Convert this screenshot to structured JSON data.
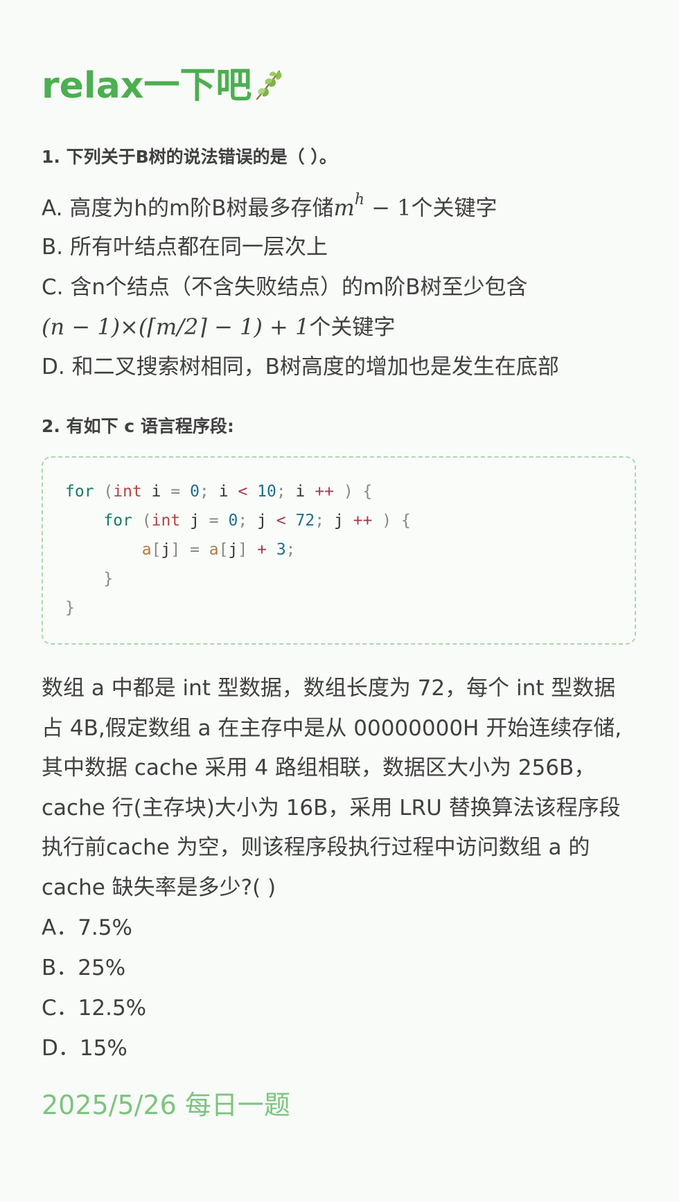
{
  "title": {
    "text": "relax一下吧",
    "icon": "leaf-icon"
  },
  "q1": {
    "heading": "1. 下列关于B树的说法错误的是（ ）。",
    "options": {
      "a": {
        "prefix": "A. 高度为h的m阶B树最多存储",
        "math_base": "m",
        "math_exp": "h",
        "math_rest": " − 1",
        "suffix": "个关键字"
      },
      "b": "B. 所有叶结点都在同一层次上",
      "c_line1": "C. 含n个结点（不含失败结点）的m阶B树至少包含",
      "c_line2": {
        "math": "(n − 1)×(⌈m/2⌉ − 1) + 1",
        "suffix": "个关键字"
      },
      "d": "D. 和二叉搜索树相同，B树高度的增加也是发生在底部"
    }
  },
  "q2": {
    "heading": "2. 有如下 c 语言程序段:",
    "code": {
      "kw_for": "for",
      "kw_int": "int",
      "var_i": "i",
      "var_j": "j",
      "arr": "a",
      "zero": "0",
      "ten": "10",
      "seventy_two": "72",
      "three": "3",
      "lt": "<",
      "inc": "++",
      "plus": "+",
      "assign": "="
    },
    "paragraph_lines": [
      "数组 a 中都是 int 型数据，数组长度为 72，每个 int 型数据",
      "占 4B,假定数组 a 在主存中是从 00000000H 开始连续存储,",
      "其中数据 cache 采用 4 路组相联，数据区大小为 256B，",
      "cache 行(主存块)大小为 16B，采用 LRU 替换算法该程序段",
      "执行前cache 为空，则该程序段执行过程中访问数组 a 的",
      "cache 缺失率是多少?( )"
    ],
    "choices": [
      "A．7.5%",
      "B．25%",
      "C．12.5%",
      "D．15%"
    ]
  },
  "footer": {
    "date": "2025/5/26 每日一题"
  },
  "colors": {
    "background": "#f8fbf7",
    "title_green": "#4caf50",
    "date_green": "#7cc47f",
    "code_border": "#a9d8ae",
    "text": "#404040"
  }
}
